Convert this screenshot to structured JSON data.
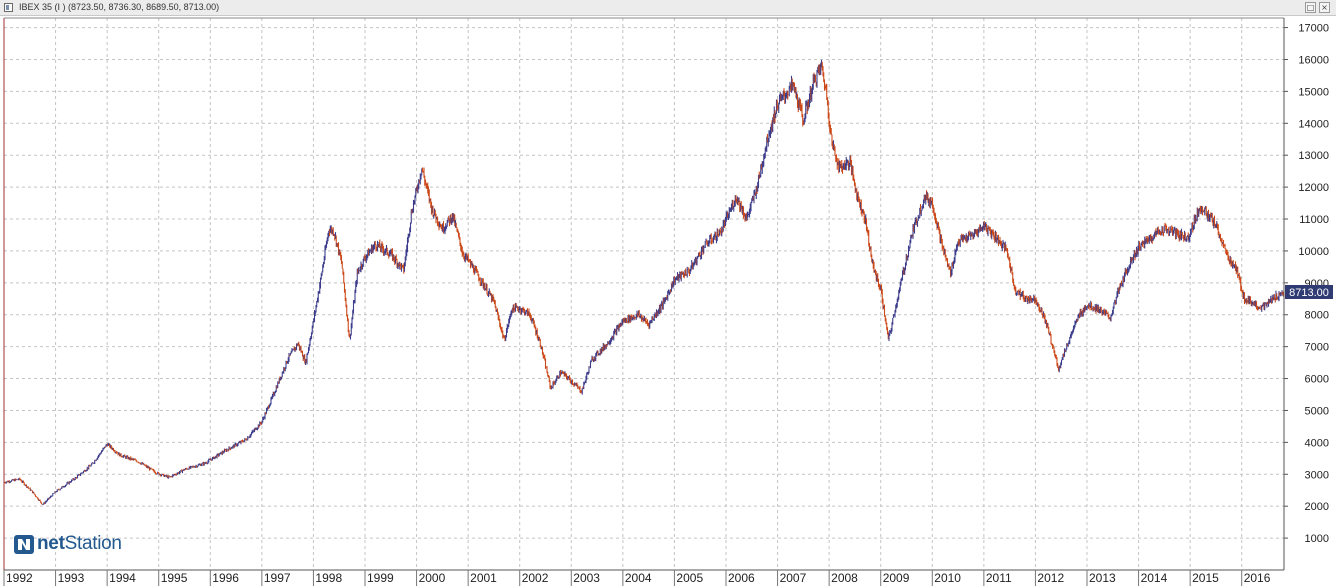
{
  "window": {
    "title": "IBEX 35 (I ) (8723.50, 8736.30, 8689.50, 8713.00)",
    "restore_glyph": "□",
    "close_glyph": "×"
  },
  "logo": {
    "prefix": "net",
    "suffix": "Station",
    "icon": "netstation-n-icon",
    "color": "#23598f"
  },
  "chart_data": {
    "type": "ohlc",
    "y_axis_side": "right",
    "ylim": [
      0,
      17300
    ],
    "yticks": [
      1000,
      2000,
      3000,
      4000,
      5000,
      6000,
      7000,
      8000,
      9000,
      10000,
      11000,
      12000,
      13000,
      14000,
      15000,
      16000,
      17000
    ],
    "ytick_labels": [
      "1000",
      "2000",
      "3000",
      "4000",
      "5000",
      "6000",
      "7000",
      "8000",
      "9000",
      "10000",
      "11000",
      "12000",
      "13000",
      "14000",
      "15000",
      "16000",
      "17000"
    ],
    "xlim": [
      1992.0,
      2016.82
    ],
    "xticks": [
      1992,
      1993,
      1994,
      1995,
      1996,
      1997,
      1998,
      1999,
      2000,
      2001,
      2002,
      2003,
      2004,
      2005,
      2006,
      2007,
      2008,
      2009,
      2010,
      2011,
      2012,
      2013,
      2014,
      2015,
      2016
    ],
    "xtick_labels": [
      "1992",
      "1993",
      "1994",
      "1995",
      "1996",
      "1997",
      "1998",
      "1999",
      "2000",
      "2001",
      "2002",
      "2003",
      "2004",
      "2005",
      "2006",
      "2007",
      "2008",
      "2009",
      "2010",
      "2011",
      "2012",
      "2013",
      "2014",
      "2015",
      "2016"
    ],
    "grid": true,
    "grid_style": "dashed",
    "last_close": 8713.0,
    "last_value_label": "8713.00",
    "colors": {
      "up": "#3d3d8c",
      "down": "#cc4a1a",
      "grid": "#c4c4c4",
      "last_value_bg": "#2f3b72",
      "frame": "#a03030"
    },
    "series_path": [
      [
        1992.0,
        2750
      ],
      [
        1992.3,
        2850
      ],
      [
        1992.55,
        2450
      ],
      [
        1992.75,
        2050
      ],
      [
        1993.0,
        2450
      ],
      [
        1993.4,
        2900
      ],
      [
        1993.7,
        3300
      ],
      [
        1994.0,
        3950
      ],
      [
        1994.25,
        3600
      ],
      [
        1994.6,
        3400
      ],
      [
        1994.95,
        3050
      ],
      [
        1995.2,
        2900
      ],
      [
        1995.5,
        3150
      ],
      [
        1995.9,
        3350
      ],
      [
        1996.3,
        3750
      ],
      [
        1996.7,
        4100
      ],
      [
        1997.0,
        4650
      ],
      [
        1997.2,
        5400
      ],
      [
        1997.5,
        6600
      ],
      [
        1997.7,
        7100
      ],
      [
        1997.85,
        6500
      ],
      [
        1998.0,
        7800
      ],
      [
        1998.15,
        9200
      ],
      [
        1998.3,
        10700
      ],
      [
        1998.4,
        10600
      ],
      [
        1998.55,
        9600
      ],
      [
        1998.7,
        7200
      ],
      [
        1998.85,
        9300
      ],
      [
        1999.0,
        9800
      ],
      [
        1999.2,
        10200
      ],
      [
        1999.5,
        9900
      ],
      [
        1999.75,
        9400
      ],
      [
        1999.9,
        11200
      ],
      [
        2000.1,
        12600
      ],
      [
        2000.3,
        11300
      ],
      [
        2000.5,
        10700
      ],
      [
        2000.7,
        11100
      ],
      [
        2000.9,
        9900
      ],
      [
        2001.0,
        9700
      ],
      [
        2001.2,
        9200
      ],
      [
        2001.5,
        8400
      ],
      [
        2001.7,
        7200
      ],
      [
        2001.85,
        8200
      ],
      [
        2002.0,
        8200
      ],
      [
        2002.2,
        8000
      ],
      [
        2002.4,
        7100
      ],
      [
        2002.6,
        5700
      ],
      [
        2002.8,
        6200
      ],
      [
        2002.95,
        6000
      ],
      [
        2003.2,
        5600
      ],
      [
        2003.4,
        6600
      ],
      [
        2003.7,
        7100
      ],
      [
        2004.0,
        7800
      ],
      [
        2004.3,
        8000
      ],
      [
        2004.5,
        7700
      ],
      [
        2004.8,
        8400
      ],
      [
        2005.0,
        9100
      ],
      [
        2005.3,
        9400
      ],
      [
        2005.6,
        10200
      ],
      [
        2005.9,
        10600
      ],
      [
        2006.2,
        11700
      ],
      [
        2006.4,
        11000
      ],
      [
        2006.6,
        12000
      ],
      [
        2006.8,
        13500
      ],
      [
        2007.0,
        14600
      ],
      [
        2007.3,
        15200
      ],
      [
        2007.5,
        14100
      ],
      [
        2007.7,
        15300
      ],
      [
        2007.85,
        15800
      ],
      [
        2007.95,
        14900
      ],
      [
        2008.05,
        13400
      ],
      [
        2008.2,
        12600
      ],
      [
        2008.4,
        12800
      ],
      [
        2008.55,
        11700
      ],
      [
        2008.7,
        11000
      ],
      [
        2008.85,
        9500
      ],
      [
        2009.0,
        8800
      ],
      [
        2009.15,
        7200
      ],
      [
        2009.35,
        8700
      ],
      [
        2009.6,
        10500
      ],
      [
        2009.85,
        11700
      ],
      [
        2010.0,
        11500
      ],
      [
        2010.2,
        10100
      ],
      [
        2010.35,
        9300
      ],
      [
        2010.5,
        10300
      ],
      [
        2010.8,
        10500
      ],
      [
        2011.0,
        10800
      ],
      [
        2011.2,
        10500
      ],
      [
        2011.45,
        10000
      ],
      [
        2011.6,
        8800
      ],
      [
        2011.8,
        8500
      ],
      [
        2012.0,
        8500
      ],
      [
        2012.2,
        7800
      ],
      [
        2012.45,
        6300
      ],
      [
        2012.6,
        7000
      ],
      [
        2012.85,
        8000
      ],
      [
        2013.0,
        8300
      ],
      [
        2013.2,
        8200
      ],
      [
        2013.45,
        7900
      ],
      [
        2013.6,
        8700
      ],
      [
        2013.85,
        9700
      ],
      [
        2014.0,
        10100
      ],
      [
        2014.3,
        10500
      ],
      [
        2014.5,
        10700
      ],
      [
        2014.8,
        10500
      ],
      [
        2014.95,
        10400
      ],
      [
        2015.2,
        11400
      ],
      [
        2015.35,
        11100
      ],
      [
        2015.5,
        10800
      ],
      [
        2015.7,
        9900
      ],
      [
        2015.9,
        9400
      ],
      [
        2016.05,
        8500
      ],
      [
        2016.2,
        8400
      ],
      [
        2016.4,
        8200
      ],
      [
        2016.6,
        8500
      ],
      [
        2016.82,
        8713
      ]
    ]
  }
}
